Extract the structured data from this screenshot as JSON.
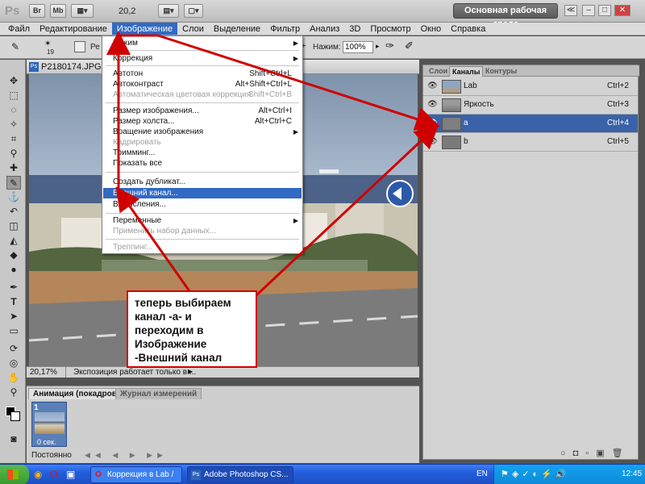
{
  "app": {
    "logo": "Ps",
    "bar_buttons": [
      "Br",
      "Mb"
    ],
    "zoom": "20,2",
    "workspace_label": "Основная рабочая среда",
    "window_controls": [
      "≪",
      "–",
      "□",
      "✕"
    ]
  },
  "menubar": [
    "Файл",
    "Редактирование",
    "Изображение",
    "Слои",
    "Выделение",
    "Фильтр",
    "Анализ",
    "3D",
    "Просмотр",
    "Окно",
    "Справка"
  ],
  "menubar_active": "Изображение",
  "options": {
    "brush_size": "19",
    "mode_prefix": "Ре",
    "pressure_label": "Нажим:",
    "pressure_value": "100%"
  },
  "document": {
    "title": "P2180174.JPG @",
    "zoom": "20,17%",
    "status": "Экспозиция работает только в ..."
  },
  "image_menu": [
    {
      "label": "Режим",
      "submenu": true
    },
    {
      "sep": true
    },
    {
      "label": "Коррекция",
      "submenu": true
    },
    {
      "sep": true
    },
    {
      "label": "Автотон",
      "shortcut": "Shift+Ctrl+L"
    },
    {
      "label": "Автоконтраст",
      "shortcut": "Alt+Shift+Ctrl+L"
    },
    {
      "label": "Автоматическая цветовая коррекция",
      "shortcut": "Shift+Ctrl+B",
      "disabled": true
    },
    {
      "sep": true
    },
    {
      "label": "Размер изображения...",
      "shortcut": "Alt+Ctrl+I"
    },
    {
      "label": "Размер холста...",
      "shortcut": "Alt+Ctrl+C"
    },
    {
      "label": "Вращение изображения",
      "submenu": true
    },
    {
      "label": "Кадрировать",
      "disabled": true
    },
    {
      "label": "Тримминг..."
    },
    {
      "label": "Показать все"
    },
    {
      "sep": true
    },
    {
      "label": "Создать дубликат..."
    },
    {
      "label": "Внешний канал...",
      "highlighted": true
    },
    {
      "label": "Вычисления..."
    },
    {
      "sep": true
    },
    {
      "label": "Переменные",
      "submenu": true
    },
    {
      "label": "Применить набор данных...",
      "disabled": true
    },
    {
      "sep": true
    },
    {
      "label": "Треппинг...",
      "disabled": true
    }
  ],
  "channels_panel": {
    "tabs": [
      "Слои",
      "Каналы",
      "Контуры"
    ],
    "active_tab": "Каналы",
    "channels": [
      {
        "name": "Lab",
        "shortcut": "Ctrl+2"
      },
      {
        "name": "Яркость",
        "shortcut": "Ctrl+3"
      },
      {
        "name": "a",
        "shortcut": "Ctrl+4",
        "selected": true
      },
      {
        "name": "b",
        "shortcut": "Ctrl+5"
      }
    ]
  },
  "animation_panel": {
    "tabs": [
      "Анимация (покадровая)",
      "Журнал измерений"
    ],
    "frame_number": "1",
    "frame_time": "0 сек.",
    "loop": "Постоянно"
  },
  "annotation": {
    "text": "теперь выбираем канал -а- и переходим в Изображение -Внешний канал",
    "color": "#d00000"
  },
  "taskbar": {
    "tasks": [
      "Коррекция в Lab / P...",
      "Adobe Photoshop CS..."
    ],
    "language": "EN",
    "clock": "12:45"
  },
  "colors": {
    "menu_highlight": "#316ac5",
    "channel_selected": "#3a62a8",
    "annotation_red": "#d00000"
  }
}
